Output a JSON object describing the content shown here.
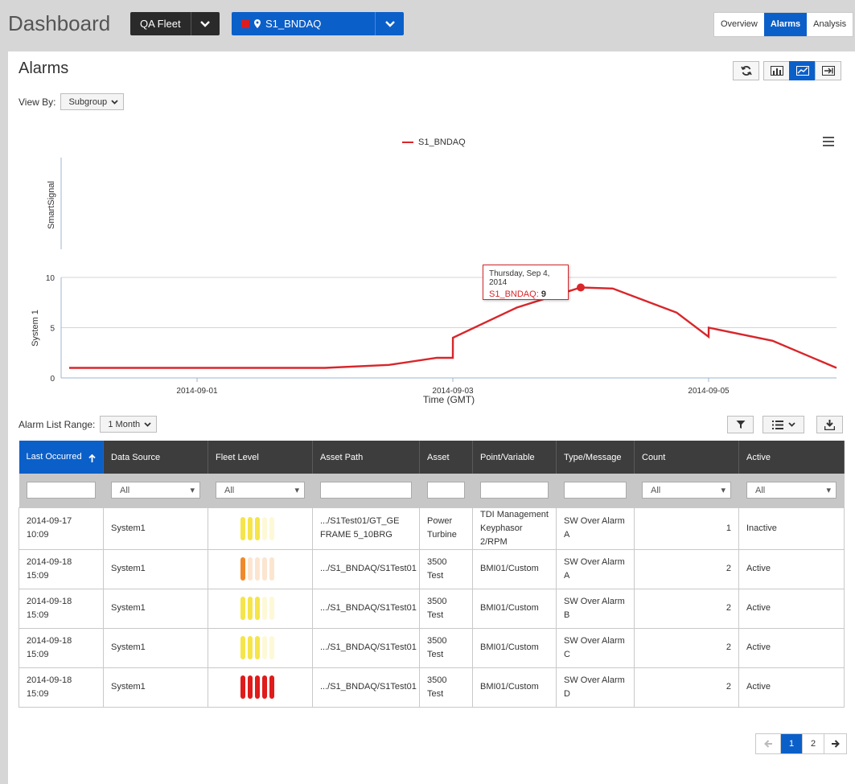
{
  "header": {
    "title": "Dashboard",
    "fleet_label": "QA Fleet",
    "asset_label": "S1_BNDAQ",
    "tabs": [
      "Overview",
      "Alarms",
      "Analysis"
    ],
    "active_tab": "Alarms"
  },
  "alarms_panel": {
    "title": "Alarms",
    "view_by_label": "View By:",
    "view_by_value": "Subgroup",
    "range_label": "Alarm List Range:",
    "range_value": "1 Month"
  },
  "chart_data": {
    "type": "line",
    "legend": [
      "S1_BNDAQ"
    ],
    "panels": [
      {
        "ylabel": "SmartSignal",
        "series": []
      },
      {
        "ylabel": "System 1",
        "ylim": [
          0,
          10
        ],
        "yticks": [
          "0",
          "5",
          "10"
        ],
        "series": [
          {
            "name": "S1_BNDAQ",
            "color": "#d8262b",
            "points": [
              [
                "2014-08-31 00:00",
                1
              ],
              [
                "2014-09-02 00:00",
                1
              ],
              [
                "2014-09-02 12:00",
                1.3
              ],
              [
                "2014-09-02 21:00",
                2
              ],
              [
                "2014-09-03 00:00",
                2
              ],
              [
                "2014-09-03 00:01",
                4
              ],
              [
                "2014-09-03 12:00",
                7
              ],
              [
                "2014-09-04 00:00",
                9
              ],
              [
                "2014-09-04 06:00",
                8.9
              ],
              [
                "2014-09-04 18:00",
                6.5
              ],
              [
                "2014-09-05 00:00",
                4.1
              ],
              [
                "2014-09-05 00:01",
                5
              ],
              [
                "2014-09-05 12:00",
                3.7
              ],
              [
                "2014-09-06 00:00",
                1
              ]
            ]
          }
        ]
      }
    ],
    "x_ticks": [
      "2014-09-01",
      "2014-09-03",
      "2014-09-05"
    ],
    "xlabel": "Time (GMT)",
    "tooltip": {
      "date": "Thursday, Sep 4, 2014",
      "series": "S1_BNDAQ:",
      "value": "9"
    }
  },
  "table": {
    "columns": [
      "Last Occurred",
      "Data Source",
      "Fleet Level",
      "Asset Path",
      "Asset",
      "Point/Variable",
      "Type/Message",
      "Count",
      "Active"
    ],
    "filter_all": "All",
    "rows": [
      {
        "last": "2014-09-17 10:09",
        "source": "System1",
        "level": {
          "color": "#f5e44a",
          "filled": 3
        },
        "path": ".../S1Test01/GT_GE FRAME 5_10BRG",
        "asset": "Power Turbine",
        "point": "TDI Management Keyphasor 2/RPM",
        "type": "SW Over Alarm A",
        "count": "1",
        "active": "Inactive"
      },
      {
        "last": "2014-09-18 15:09",
        "source": "System1",
        "level": {
          "color": "#f0892a",
          "filled": 1
        },
        "path": ".../S1_BNDAQ/S1Test01",
        "asset": "3500 Test",
        "point": "BMI01/Custom",
        "type": "SW Over Alarm A",
        "count": "2",
        "active": "Active"
      },
      {
        "last": "2014-09-18 15:09",
        "source": "System1",
        "level": {
          "color": "#f5e44a",
          "filled": 3
        },
        "path": ".../S1_BNDAQ/S1Test01",
        "asset": "3500 Test",
        "point": "BMI01/Custom",
        "type": "SW Over Alarm B",
        "count": "2",
        "active": "Active"
      },
      {
        "last": "2014-09-18 15:09",
        "source": "System1",
        "level": {
          "color": "#f5e44a",
          "filled": 3
        },
        "path": ".../S1_BNDAQ/S1Test01",
        "asset": "3500 Test",
        "point": "BMI01/Custom",
        "type": "SW Over Alarm C",
        "count": "2",
        "active": "Active"
      },
      {
        "last": "2014-09-18 15:09",
        "source": "System1",
        "level": {
          "color": "#e01b1b",
          "filled": 5
        },
        "path": ".../S1_BNDAQ/S1Test01",
        "asset": "3500 Test",
        "point": "BMI01/Custom",
        "type": "SW Over Alarm D",
        "count": "2",
        "active": "Active"
      }
    ]
  },
  "pagination": {
    "pages": [
      "1",
      "2"
    ],
    "current": "1"
  }
}
